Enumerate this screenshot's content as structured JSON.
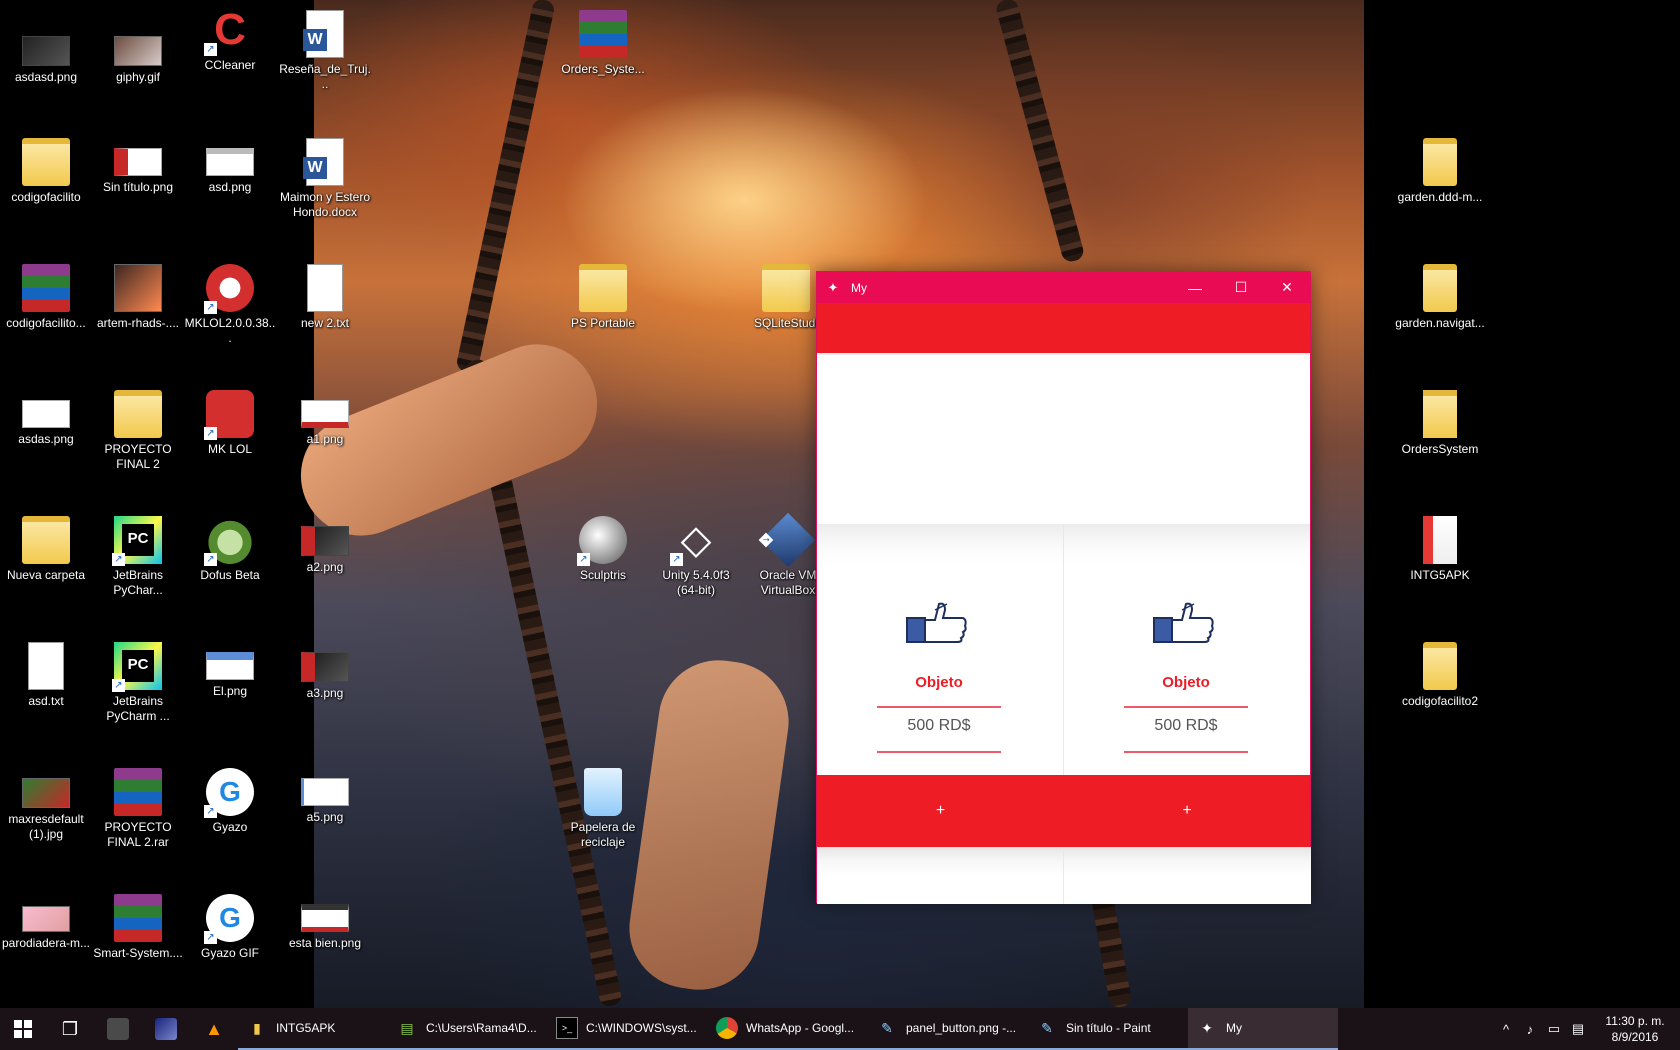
{
  "desktop": {
    "icons": [
      {
        "label": "asdasd.png",
        "icon": "image-file-icon"
      },
      {
        "label": "giphy.gif",
        "icon": "image-file-icon"
      },
      {
        "label": "CCleaner",
        "icon": "ccleaner-icon"
      },
      {
        "label": "Reseña_de_Truj...",
        "icon": "word-document-icon"
      },
      {
        "label": "codigofacilito",
        "icon": "folder-icon"
      },
      {
        "label": "Sin título.png",
        "icon": "image-file-icon"
      },
      {
        "label": "asd.png",
        "icon": "image-file-icon"
      },
      {
        "label": "Maimon y Estero Hondo.docx",
        "icon": "word-document-icon"
      },
      {
        "label": "codigofacilito...",
        "icon": "winrar-archive-icon"
      },
      {
        "label": "artem-rhads-....",
        "icon": "image-file-icon"
      },
      {
        "label": "MKLOL2.0.0.38...",
        "icon": "installer-icon"
      },
      {
        "label": "new 2.txt",
        "icon": "text-file-icon"
      },
      {
        "label": "asdas.png",
        "icon": "image-file-icon"
      },
      {
        "label": "PROYECTO FINAL 2",
        "icon": "folder-icon"
      },
      {
        "label": "MK LOL",
        "icon": "mk-lol-icon"
      },
      {
        "label": "a1.png",
        "icon": "image-file-icon"
      },
      {
        "label": "Nueva carpeta",
        "icon": "folder-icon"
      },
      {
        "label": "JetBrains PyChar...",
        "icon": "pycharm-icon"
      },
      {
        "label": "Dofus Beta",
        "icon": "dofus-icon"
      },
      {
        "label": "a2.png",
        "icon": "image-file-icon"
      },
      {
        "label": "asd.txt",
        "icon": "text-file-icon"
      },
      {
        "label": "JetBrains PyCharm ...",
        "icon": "pycharm-icon"
      },
      {
        "label": "El.png",
        "icon": "image-file-icon"
      },
      {
        "label": "a3.png",
        "icon": "image-file-icon"
      },
      {
        "label": "maxresdefault (1).jpg",
        "icon": "image-file-icon"
      },
      {
        "label": "PROYECTO FINAL 2.rar",
        "icon": "winrar-archive-icon"
      },
      {
        "label": "Gyazo",
        "icon": "gyazo-icon"
      },
      {
        "label": "a5.png",
        "icon": "image-file-icon"
      },
      {
        "label": "parodiadera-m...",
        "icon": "image-file-icon"
      },
      {
        "label": "Smart-System....",
        "icon": "winrar-archive-icon"
      },
      {
        "label": "Gyazo GIF",
        "icon": "gyazo-gif-icon"
      },
      {
        "label": "esta bien.png",
        "icon": "image-file-icon"
      },
      {
        "label": "Orders_Syste...",
        "icon": "winrar-archive-icon"
      },
      {
        "label": "PS Portable",
        "icon": "folder-icon"
      },
      {
        "label": "SQLiteStudi",
        "icon": "folder-icon"
      },
      {
        "label": "Sculptris",
        "icon": "sculptris-icon"
      },
      {
        "label": "Unity 5.4.0f3 (64-bit)",
        "icon": "unity-icon"
      },
      {
        "label": "Oracle VM VirtualBox",
        "icon": "virtualbox-icon"
      },
      {
        "label": "Papelera de reciclaje",
        "icon": "recycle-bin-icon"
      },
      {
        "label": "garden.ddd-m...",
        "icon": "folder-icon"
      },
      {
        "label": "garden.navigat...",
        "icon": "folder-icon"
      },
      {
        "label": "OrdersSystem",
        "icon": "music-folder-icon"
      },
      {
        "label": "INTG5APK",
        "icon": "folder-icon"
      },
      {
        "label": "codigofacilito2",
        "icon": "folder-icon"
      }
    ]
  },
  "app_window": {
    "title": "My",
    "minimize_glyph": "—",
    "maximize_glyph": "☐",
    "close_glyph": "✕",
    "accent_color": "#ee1c25",
    "titlebar_color": "#e90c55",
    "products": [
      {
        "name": "Objeto",
        "price": "500 RD$",
        "button_label": "+",
        "icon": "thumbs-up-icon"
      },
      {
        "name": "Objeto",
        "price": "500 RD$",
        "button_label": "+",
        "icon": "thumbs-up-icon"
      }
    ]
  },
  "taskbar": {
    "tasks": [
      {
        "label": "INTG5APK",
        "icon": "folder-icon"
      },
      {
        "label": "C:\\Users\\Rama4\\D...",
        "icon": "notepad-icon"
      },
      {
        "label": "C:\\WINDOWS\\syst...",
        "icon": "cmd-icon"
      },
      {
        "label": "WhatsApp - Googl...",
        "icon": "chrome-icon"
      },
      {
        "label": "panel_button.png -...",
        "icon": "paint-icon"
      },
      {
        "label": "Sin título - Paint",
        "icon": "paint-icon"
      },
      {
        "label": "My",
        "icon": "kivy-icon"
      }
    ],
    "clock": {
      "time": "11:30 p. m.",
      "date": "8/9/2016"
    }
  }
}
